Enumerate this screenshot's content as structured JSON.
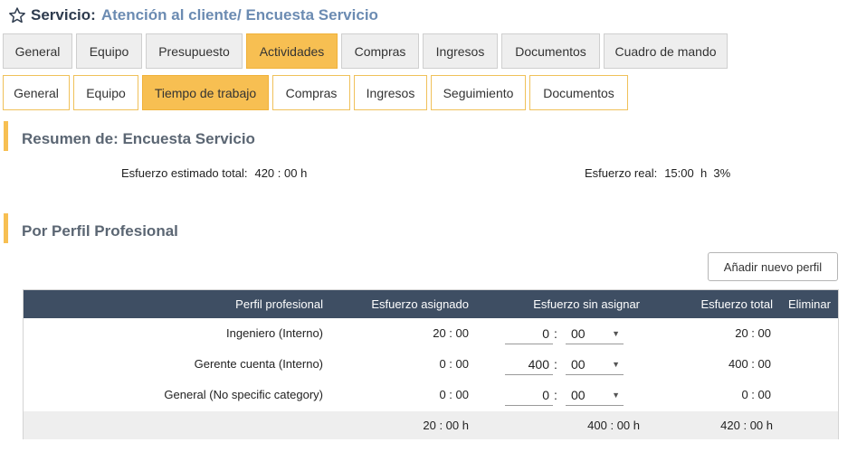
{
  "header": {
    "prefix": "Servicio:",
    "title": "Atención al cliente/ Encuesta Servicio"
  },
  "tabs_primary": [
    {
      "label": "General",
      "active": false
    },
    {
      "label": "Equipo",
      "active": false
    },
    {
      "label": "Presupuesto",
      "active": false
    },
    {
      "label": "Actividades",
      "active": true
    },
    {
      "label": "Compras",
      "active": false
    },
    {
      "label": "Ingresos",
      "active": false
    },
    {
      "label": "Documentos",
      "active": false
    },
    {
      "label": "Cuadro de mando",
      "active": false
    }
  ],
  "tabs_secondary": [
    {
      "label": "General",
      "active": false
    },
    {
      "label": "Equipo",
      "active": false
    },
    {
      "label": "Tiempo de trabajo",
      "active": true
    },
    {
      "label": "Compras",
      "active": false
    },
    {
      "label": "Ingresos",
      "active": false
    },
    {
      "label": "Seguimiento",
      "active": false
    },
    {
      "label": "Documentos",
      "active": false
    }
  ],
  "summary": {
    "title": "Resumen de: Encuesta Servicio",
    "estimated_label": "Esfuerzo estimado total:",
    "estimated_value": "420 : 00 h",
    "real_label": "Esfuerzo real:",
    "real_value": "15:00  h  3%"
  },
  "profiles": {
    "title": "Por Perfil Profesional",
    "add_button": "Añadir nuevo perfil",
    "columns": {
      "profile": "Perfil profesional",
      "assigned": "Esfuerzo asignado",
      "unassigned": "Esfuerzo sin asignar",
      "total": "Esfuerzo total",
      "delete": "Eliminar"
    },
    "rows": [
      {
        "profile": "Ingeniero (Interno)",
        "assigned": "20 : 00",
        "hours": "0",
        "minutes": "00",
        "total": "20 : 00"
      },
      {
        "profile": "Gerente cuenta (Interno)",
        "assigned": "0 : 00",
        "hours": "400",
        "minutes": "00",
        "total": "400 : 00"
      },
      {
        "profile": "General (No specific category)",
        "assigned": "0 : 00",
        "hours": "0",
        "minutes": "00",
        "total": "0 : 00"
      }
    ],
    "footer": {
      "assigned": "20 : 00 h",
      "unassigned": "400 : 00 h",
      "total": "420 : 00 h"
    },
    "separator": ":"
  },
  "colors": {
    "accent": "#f7bf52",
    "header_dark": "#3e4e63",
    "title_blue": "#6b8bb2"
  }
}
